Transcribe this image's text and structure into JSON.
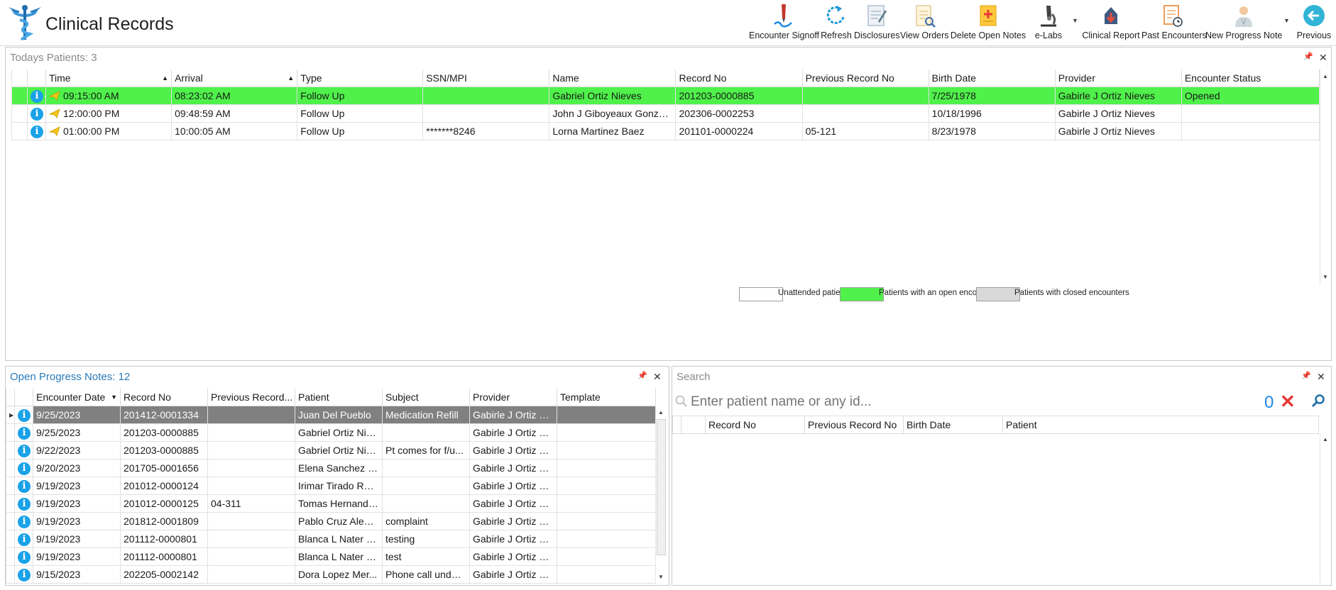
{
  "app": {
    "title": "Clinical Records"
  },
  "toolbar": {
    "encounter_signoff": "Encounter Signoff",
    "refresh": "Refresh",
    "disclosures": "Disclosures",
    "view_orders": "View Orders",
    "delete_open_notes": "Delete Open Notes",
    "elabs": "e-Labs",
    "clinical_report": "Clinical Report",
    "past_encounters": "Past Encounters",
    "new_progress_note": "New Progress Note",
    "previous": "Previous"
  },
  "todays": {
    "title": "Todays Patients:",
    "count": "3",
    "columns": [
      "Time",
      "Arrival",
      "Type",
      "SSN/MPI",
      "Name",
      "Record No",
      "Previous Record No",
      "Birth Date",
      "Provider",
      "Encounter Status"
    ],
    "rows": [
      {
        "time": "09:15:00 AM",
        "arrival": "08:23:02 AM",
        "type": "Follow Up",
        "ssn": "",
        "name": "Gabriel Ortiz Nieves",
        "record": "201203-0000885",
        "prev": "",
        "birth": "7/25/1978",
        "provider": "Gabirle J Ortiz Nieves",
        "status": "Opened"
      },
      {
        "time": "12:00:00 PM",
        "arrival": "09:48:59 AM",
        "type": "Follow Up",
        "ssn": "",
        "name": "John J Giboyeaux Gonzalez",
        "record": "202306-0002253",
        "prev": "",
        "birth": "10/18/1996",
        "provider": "Gabirle J Ortiz Nieves",
        "status": ""
      },
      {
        "time": "01:00:00 PM",
        "arrival": "10:00:05 AM",
        "type": "Follow Up",
        "ssn": "*******8246",
        "name": "Lorna Martinez Baez",
        "record": "201101-0000224",
        "prev": "05-121",
        "birth": "8/23/1978",
        "provider": "Gabirle J Ortiz Nieves",
        "status": ""
      }
    ],
    "legend": {
      "unattended": "Unattended patients",
      "open": "Patients with an open encounter",
      "closed": "Patients with closed encounters"
    },
    "colors": {
      "open": "#4ff14a",
      "closed": "#d9d9d9",
      "unattended": "#ffffff"
    }
  },
  "notes": {
    "title": "Open Progress Notes:",
    "count": "12",
    "columns": [
      "Encounter Date",
      "Record No",
      "Previous Record...",
      "Patient",
      "Subject",
      "Provider",
      "Template"
    ],
    "rows": [
      {
        "date": "9/25/2023",
        "record": "201412-0001334",
        "prev": "",
        "patient": "Juan Del Pueblo",
        "subject": "Medication Refill",
        "provider": "Gabirle J Ortiz N...",
        "template": ""
      },
      {
        "date": "9/25/2023",
        "record": "201203-0000885",
        "prev": "",
        "patient": "Gabriel Ortiz Nie...",
        "subject": "",
        "provider": "Gabirle J Ortiz N...",
        "template": ""
      },
      {
        "date": "9/22/2023",
        "record": "201203-0000885",
        "prev": "",
        "patient": "Gabriel Ortiz Nie...",
        "subject": "Pt comes for f/u...",
        "provider": "Gabirle J Ortiz N...",
        "template": ""
      },
      {
        "date": "9/20/2023",
        "record": "201705-0001656",
        "prev": "",
        "patient": "Elena Sanchez Ri...",
        "subject": "",
        "provider": "Gabirle J Ortiz N...",
        "template": ""
      },
      {
        "date": "9/19/2023",
        "record": "201012-0000124",
        "prev": "",
        "patient": "Irimar Tirado Rol...",
        "subject": "",
        "provider": "Gabirle J Ortiz N...",
        "template": ""
      },
      {
        "date": "9/19/2023",
        "record": "201012-0000125",
        "prev": "04-311",
        "patient": "Tomas Hernande...",
        "subject": "",
        "provider": "Gabirle J Ortiz N...",
        "template": ""
      },
      {
        "date": "9/19/2023",
        "record": "201812-0001809",
        "prev": "",
        "patient": "Pablo Cruz Alem...",
        "subject": "complaint",
        "provider": "Gabirle J Ortiz N...",
        "template": ""
      },
      {
        "date": "9/19/2023",
        "record": "201112-0000801",
        "prev": "",
        "patient": "Blanca L Nater B...",
        "subject": "testing",
        "provider": "Gabirle J Ortiz N...",
        "template": ""
      },
      {
        "date": "9/19/2023",
        "record": "201112-0000801",
        "prev": "",
        "patient": "Blanca L Nater B...",
        "subject": "test",
        "provider": "Gabirle J Ortiz N...",
        "template": ""
      },
      {
        "date": "9/15/2023",
        "record": "202205-0002142",
        "prev": "",
        "patient": "Dora Lopez Mer...",
        "subject": "Phone call under...",
        "provider": "Gabirle J Ortiz N...",
        "template": ""
      }
    ]
  },
  "search": {
    "title": "Search",
    "placeholder": "Enter patient name or any id...",
    "count": "0",
    "columns": [
      "Record No",
      "Previous Record No",
      "Birth Date",
      "Patient"
    ]
  }
}
